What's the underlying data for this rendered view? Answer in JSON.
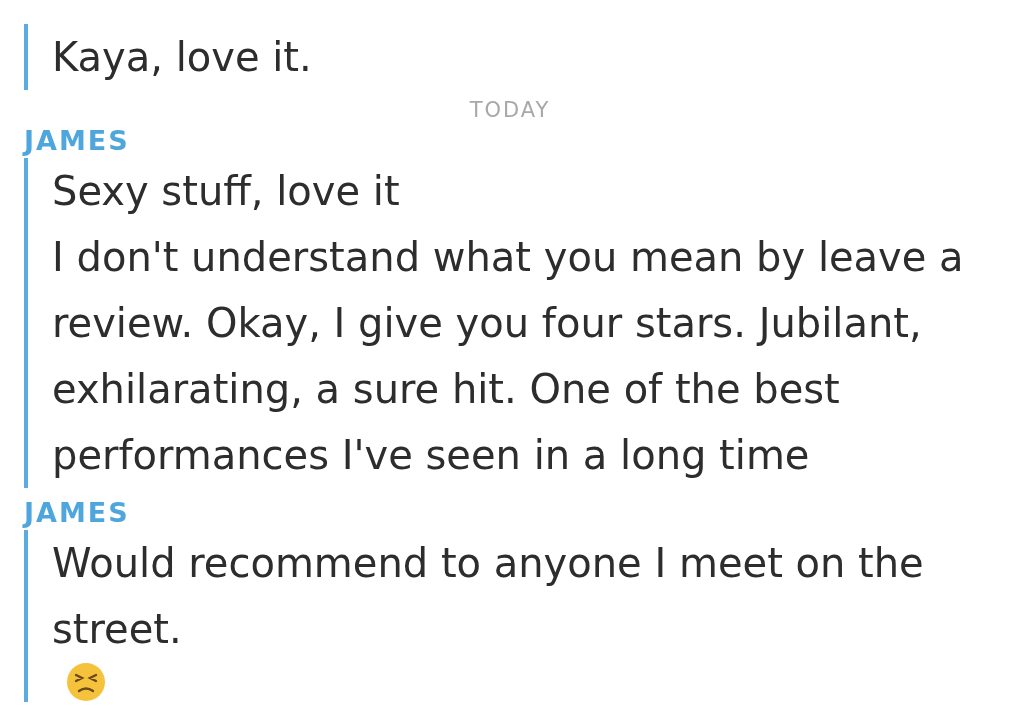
{
  "chat": [
    {
      "kind": "messages",
      "messages": [
        {
          "text": "Kaya, love it."
        }
      ]
    },
    {
      "kind": "date",
      "label": "TODAY"
    },
    {
      "kind": "messages",
      "sender": "JAMES",
      "messages": [
        {
          "text": "Sexy stuff, love it"
        },
        {
          "text": "I don't understand what you mean by leave a review. Okay, I give you four stars. Jubilant, exhilarating, a sure hit. One of the best performances I've seen in a long time"
        }
      ]
    },
    {
      "kind": "messages",
      "sender": "JAMES",
      "messages": [
        {
          "kind": "text_with_emoji",
          "text": "Would recommend to anyone I meet on the street."
        }
      ]
    }
  ]
}
